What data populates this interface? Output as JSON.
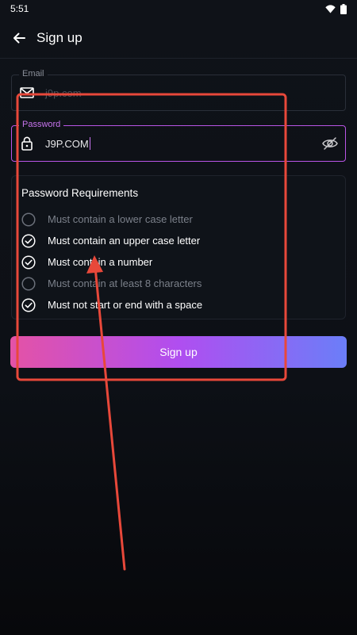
{
  "status_bar": {
    "time": "5:51",
    "icons": [
      "wifi-icon",
      "battery-icon"
    ]
  },
  "app_bar": {
    "title": "Sign up",
    "back_icon": "arrow-left-icon"
  },
  "email_field": {
    "label": "Email",
    "value": "j9p.com",
    "icon": "mail-icon"
  },
  "password_field": {
    "label": "Password",
    "value": "J9P.COM",
    "icon": "lock-icon",
    "toggle_icon": "eye-off-icon"
  },
  "requirements": {
    "title": "Password Requirements",
    "items": [
      {
        "text": "Must contain a lower case letter",
        "met": false
      },
      {
        "text": "Must contain an upper case letter",
        "met": true
      },
      {
        "text": "Must contain a number",
        "met": true
      },
      {
        "text": "Must contain at least 8 characters",
        "met": false
      },
      {
        "text": "Must not start or end with a space",
        "met": true
      }
    ]
  },
  "signup_button": {
    "label": "Sign up"
  },
  "colors": {
    "accent": "#b955e6",
    "button_start": "#e452a6",
    "button_end": "#6b7ef8",
    "annotation": "#e8483a"
  }
}
